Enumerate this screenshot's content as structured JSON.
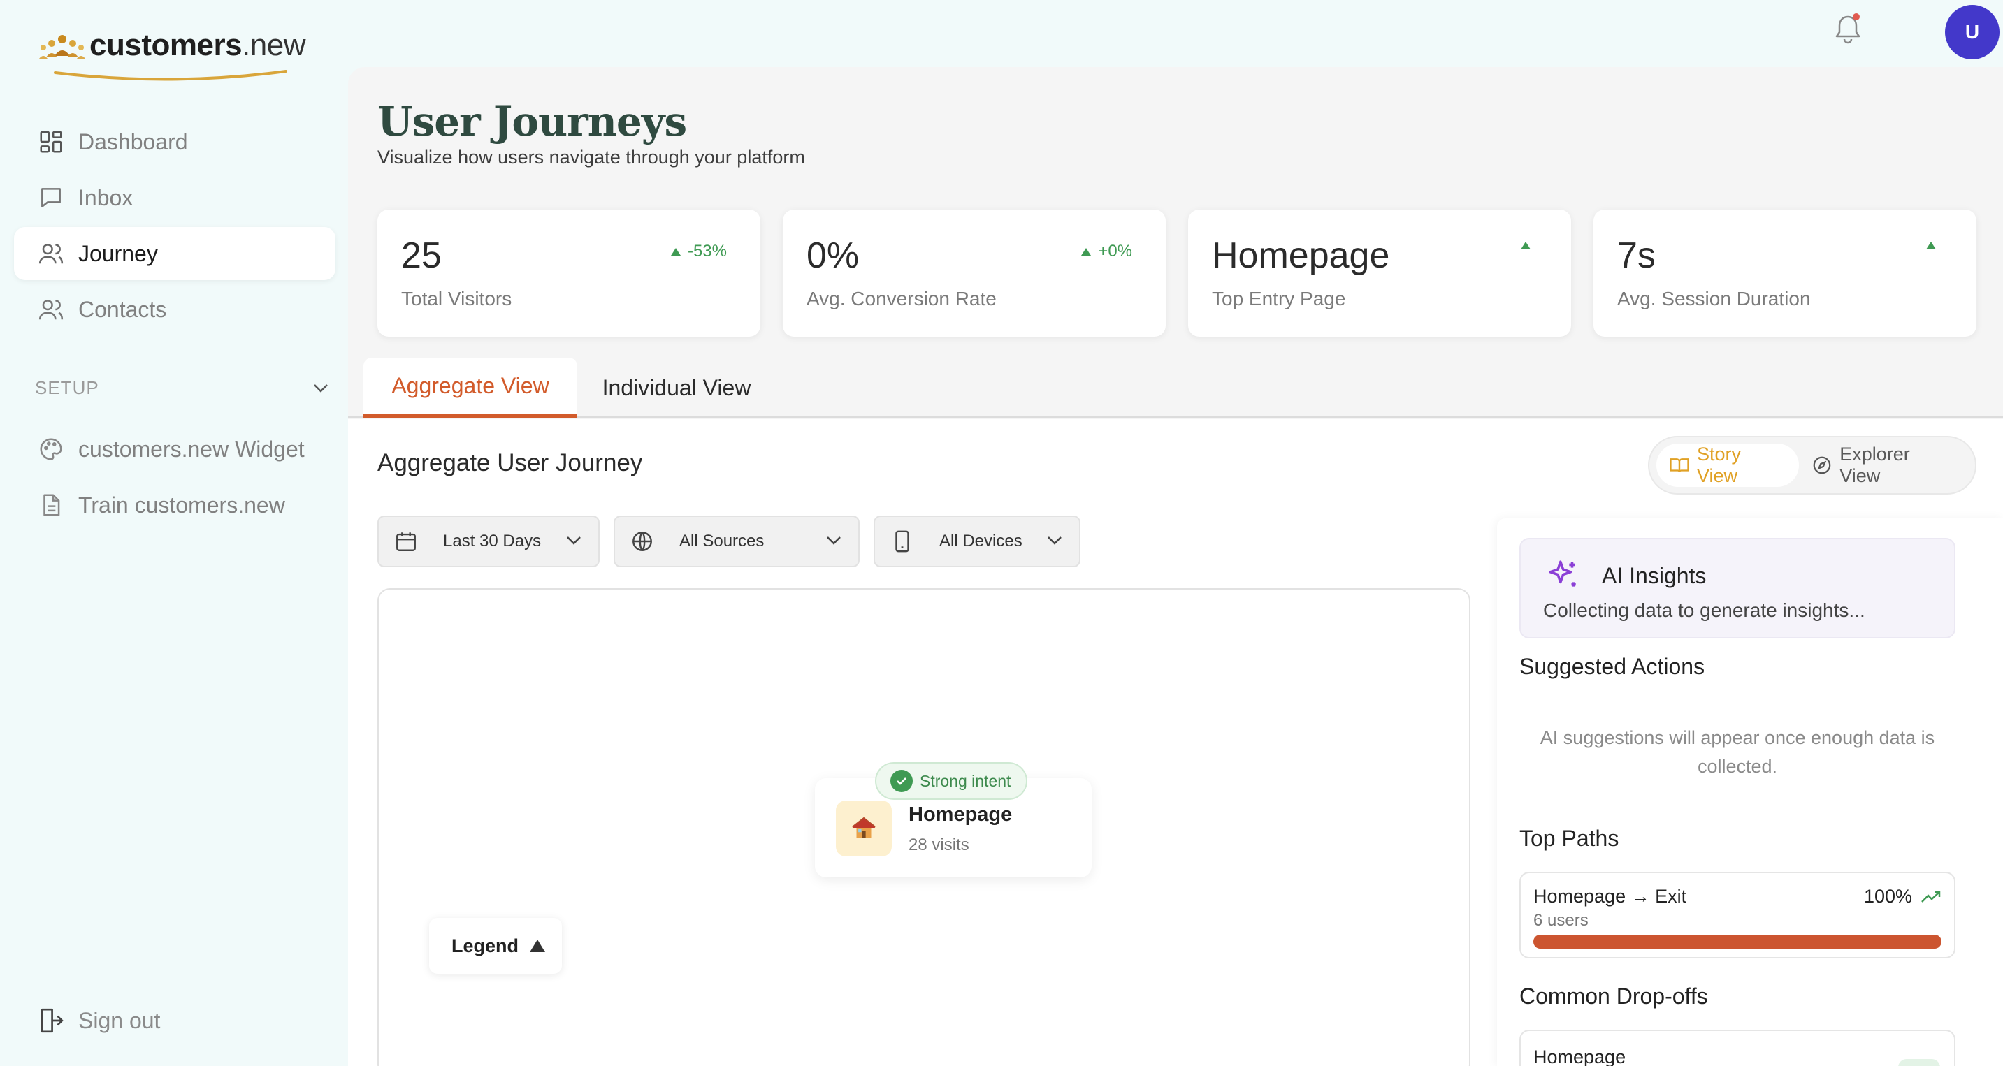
{
  "brand": {
    "name_main": "customers",
    "name_suffix": ".new"
  },
  "sidebar": {
    "items": [
      {
        "label": "Dashboard",
        "icon": "dashboard-grid-icon"
      },
      {
        "label": "Inbox",
        "icon": "chat-bubble-icon"
      },
      {
        "label": "Journey",
        "icon": "users-icon",
        "active": true
      },
      {
        "label": "Contacts",
        "icon": "users-icon"
      }
    ],
    "setup_label": "SETUP",
    "setup_items": [
      {
        "label": "customers.new Widget",
        "icon": "palette-icon"
      },
      {
        "label": "Train customers.new",
        "icon": "document-icon"
      }
    ],
    "signout_label": "Sign out"
  },
  "topbar": {
    "avatar_initial": "U",
    "notification_dot_color": "#e05a4f"
  },
  "page": {
    "title": "User Journeys",
    "subtitle": "Visualize how users navigate through your platform"
  },
  "stats": [
    {
      "value": "25",
      "label": "Total Visitors",
      "change": "-53%"
    },
    {
      "value": "0%",
      "label": "Avg. Conversion Rate",
      "change": "+0%"
    },
    {
      "value": "Homepage",
      "label": "Top Entry Page",
      "change": ""
    },
    {
      "value": "7s",
      "label": "Avg. Session Duration",
      "change": ""
    }
  ],
  "tabs": [
    {
      "label": "Aggregate View",
      "active": true
    },
    {
      "label": "Individual View",
      "active": false
    }
  ],
  "panel": {
    "title": "Aggregate User Journey",
    "view_toggle": [
      {
        "label": "Story View",
        "active": true,
        "icon": "book-icon"
      },
      {
        "label": "Explorer View",
        "active": false,
        "icon": "compass-icon"
      }
    ],
    "filters": [
      {
        "label": "Last 30 Days",
        "icon": "calendar-icon"
      },
      {
        "label": "All Sources",
        "icon": "globe-icon"
      },
      {
        "label": "All Devices",
        "icon": "phone-icon"
      }
    ]
  },
  "journey_node": {
    "badge": "Strong intent",
    "name": "Homepage",
    "visits": "28 visits",
    "icon": "house-icon"
  },
  "legend_label": "Legend",
  "insights": {
    "title": "AI Insights",
    "status": "Collecting data to generate insights...",
    "suggested_title": "Suggested Actions",
    "suggested_text": "AI suggestions will appear once enough data is collected.",
    "top_paths_title": "Top Paths",
    "top_paths": [
      {
        "path": "Homepage → Exit",
        "users": "6 users",
        "percent": "100%",
        "fill": 1.0
      }
    ],
    "dropoffs_title": "Common Drop-offs",
    "dropoffs": [
      {
        "page": "Homepage"
      }
    ]
  },
  "colors": {
    "accent_orange": "#d25b2b",
    "story_active": "#e0a125",
    "positive_green": "#3f9a53",
    "avatar_bg": "#4338ca",
    "title_green": "#2f4a40"
  }
}
